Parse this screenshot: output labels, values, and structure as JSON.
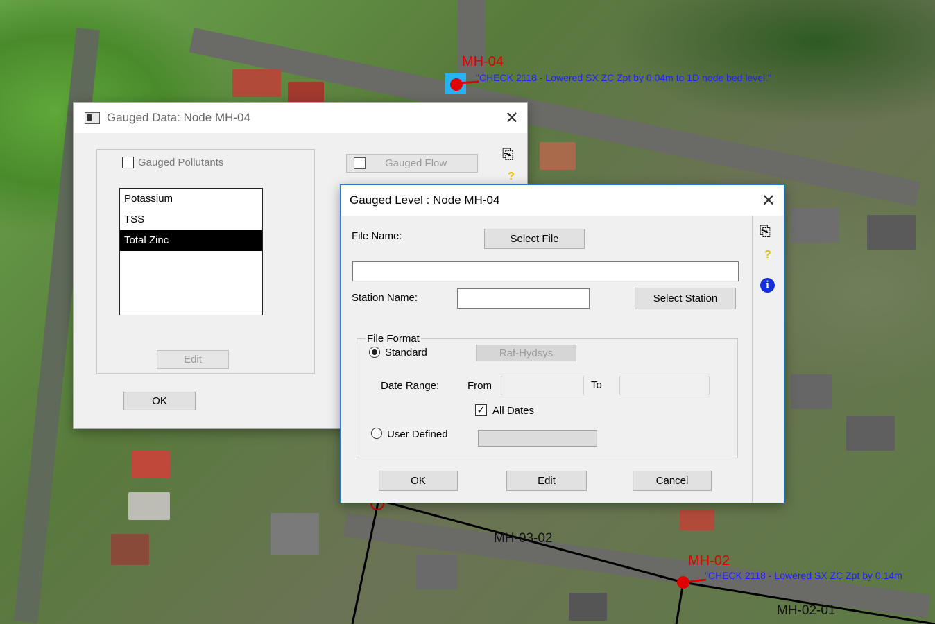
{
  "map": {
    "nodes": [
      {
        "id": "mh04",
        "label": "MH-04"
      },
      {
        "id": "mh02",
        "label": "MH-02"
      }
    ],
    "notes": {
      "mh04_note": "\"CHECK 2118 - Lowered SX ZC Zpt by 0.04m to 1D node bed level.\"",
      "mh02_note": "\"CHECK 2118 - Lowered SX ZC Zpt by 0.14m"
    },
    "links": {
      "mh03_02": "MH-03-02",
      "mh02_01": "MH-02-01"
    },
    "colors": {
      "node": "#e00000",
      "note": "#1f1fff",
      "link": "#000000"
    }
  },
  "gauged_data": {
    "title": "Gauged Data: Node MH-04",
    "pollutants_label": "Gauged Pollutants",
    "pollutants_checked": false,
    "pollutants": [
      "Potassium",
      "TSS",
      "Total Zinc"
    ],
    "selected_pollutant": "Total Zinc",
    "edit_label": "Edit",
    "ok_label": "OK",
    "flow_label": "Gauged Flow",
    "flow_checked": false,
    "icons": [
      "copy-icon",
      "help-icon"
    ]
  },
  "gauged_level": {
    "title": "Gauged Level : Node MH-04",
    "file_name_label": "File Name:",
    "select_file_label": "Select File",
    "file_name_value": "",
    "station_name_label": "Station Name:",
    "station_name_value": "",
    "select_station_label": "Select Station",
    "file_format_label": "File Format",
    "standard_label": "Standard",
    "standard_selected": true,
    "raf_label": "Raf-Hydsys",
    "date_range_label": "Date Range:",
    "from_label": "From",
    "from_value": "",
    "to_label": "To",
    "to_value": "",
    "all_dates_label": "All Dates",
    "all_dates_checked": true,
    "user_defined_label": "User Defined",
    "user_defined_selected": false,
    "user_defined_value": "",
    "ok_label": "OK",
    "edit_label": "Edit",
    "cancel_label": "Cancel",
    "icons": [
      "copy-icon",
      "help-icon",
      "info-icon"
    ]
  }
}
